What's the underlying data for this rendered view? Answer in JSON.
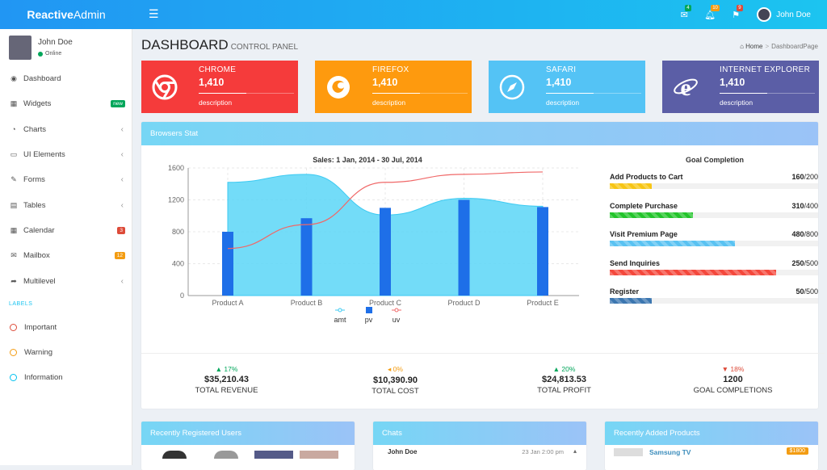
{
  "topbar": {
    "brand_bold": "Reactive",
    "brand_rest": "Admin",
    "badges": {
      "mail": "4",
      "bell": "10",
      "flag": "9"
    },
    "user": "John Doe"
  },
  "sidebar": {
    "user": {
      "name": "John Doe",
      "status": "Online"
    },
    "items": [
      {
        "label": "Dashboard",
        "icon": "dashboard-icon"
      },
      {
        "label": "Widgets",
        "icon": "grid-icon",
        "badge": "new",
        "badge_color": "#00a65a"
      },
      {
        "label": "Charts",
        "icon": "pie-chart-icon",
        "chevron": "‹"
      },
      {
        "label": "UI Elements",
        "icon": "laptop-icon",
        "chevron": "‹"
      },
      {
        "label": "Forms",
        "icon": "edit-icon",
        "chevron": "‹"
      },
      {
        "label": "Tables",
        "icon": "table-icon",
        "chevron": "‹"
      },
      {
        "label": "Calendar",
        "icon": "calendar-icon",
        "badge": "3",
        "badge_color": "#dd4b39"
      },
      {
        "label": "Mailbox",
        "icon": "envelope-icon",
        "badge": "12",
        "badge_color": "#f39c12"
      },
      {
        "label": "Multilevel",
        "icon": "share-icon",
        "chevron": "‹"
      }
    ],
    "labels_header": "LABELS",
    "labels": [
      {
        "label": "Important",
        "color": "#dd4b39"
      },
      {
        "label": "Warning",
        "color": "#f39c12"
      },
      {
        "label": "Information",
        "color": "#00c0ef"
      }
    ]
  },
  "page": {
    "title": "DASHBOARD",
    "subtitle": "CONTROL PANEL",
    "breadcrumb_home": "Home",
    "breadcrumb_sep": ">",
    "breadcrumb_current": "DashboardPage"
  },
  "infoboxes": [
    {
      "name": "CHROME",
      "value": "1,410",
      "desc": "description",
      "color": "#f53b3b",
      "icon": "chrome-icon",
      "progress": 0.5
    },
    {
      "name": "FIREFOX",
      "value": "1,410",
      "desc": "description",
      "color": "#fe9a0e",
      "icon": "firefox-icon",
      "progress": 0.5
    },
    {
      "name": "SAFARI",
      "value": "1,410",
      "desc": "description",
      "color": "#54c3f5",
      "icon": "safari-icon",
      "progress": 0.5
    },
    {
      "name": "INTERNET EXPLORER",
      "value": "1,410",
      "desc": "description",
      "color": "#5b5ea6",
      "icon": "ie-icon",
      "progress": 0.5
    }
  ],
  "browsers_panel": {
    "title": "Browsers Stat"
  },
  "chart_data": {
    "type": "bar",
    "title": "Sales: 1 Jan, 2014 - 30 Jul, 2014",
    "categories": [
      "Product A",
      "Product B",
      "Product C",
      "Product D",
      "Product E"
    ],
    "ylim": [
      0,
      1600
    ],
    "yticks": [
      0,
      400,
      800,
      1200,
      1600
    ],
    "grid": true,
    "legend_position": "bottom",
    "series": [
      {
        "name": "amt",
        "kind": "area",
        "color": "#5ad6f7",
        "values": [
          1420,
          1520,
          1010,
          1220,
          1120
        ]
      },
      {
        "name": "pv",
        "kind": "bar",
        "color": "#1e6fe8",
        "values": [
          800,
          970,
          1100,
          1200,
          1110
        ]
      },
      {
        "name": "uv",
        "kind": "line",
        "color": "#f06868",
        "values": [
          590,
          890,
          1420,
          1520,
          1550
        ]
      }
    ]
  },
  "goals": {
    "title": "Goal Completion",
    "items": [
      {
        "label": "Add Products to Cart",
        "done": "160",
        "total": "/200",
        "fraction": 0.2,
        "color": "#f7c514"
      },
      {
        "label": "Complete Purchase",
        "done": "310",
        "total": "/400",
        "fraction": 0.4,
        "color": "#22c42a"
      },
      {
        "label": "Visit Premium Page",
        "done": "480",
        "total": "/800",
        "fraction": 0.6,
        "color": "#59c2f2"
      },
      {
        "label": "Send Inquiries",
        "done": "250",
        "total": "/500",
        "fraction": 0.8,
        "color": "#f4483c"
      },
      {
        "label": "Register",
        "done": "50",
        "total": "/500",
        "fraction": 0.2,
        "color": "#3b76b0"
      }
    ]
  },
  "stats": [
    {
      "pct": "▲ 17%",
      "color": "#00a65a",
      "amount": "$35,210.43",
      "label": "TOTAL REVENUE"
    },
    {
      "pct": "◂ 0%",
      "color": "#f39c12",
      "amount": "$10,390.90",
      "label": "TOTAL COST"
    },
    {
      "pct": "▲ 20%",
      "color": "#00a65a",
      "amount": "$24,813.53",
      "label": "TOTAL PROFIT"
    },
    {
      "pct": "▼ 18%",
      "color": "#dd4b39",
      "amount": "1200",
      "label": "GOAL COMPLETIONS"
    }
  ],
  "bottom_panels": {
    "users": {
      "title": "Recently Registered Users"
    },
    "chats": {
      "title": "Chats",
      "name": "John Doe",
      "time": "23 Jan 2:00 pm"
    },
    "products": {
      "title": "Recently Added Products",
      "product": "Samsung TV",
      "price": "$1800"
    }
  }
}
